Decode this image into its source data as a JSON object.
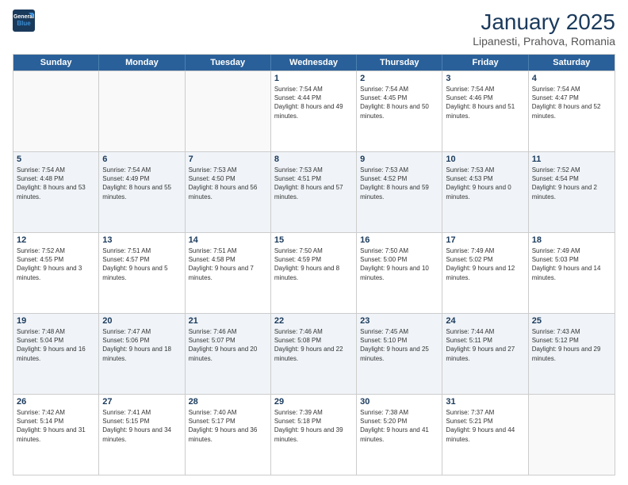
{
  "header": {
    "logo_line1": "General",
    "logo_line2": "Blue",
    "month": "January 2025",
    "location": "Lipanesti, Prahova, Romania"
  },
  "weekdays": [
    "Sunday",
    "Monday",
    "Tuesday",
    "Wednesday",
    "Thursday",
    "Friday",
    "Saturday"
  ],
  "rows": [
    [
      {
        "day": "",
        "sunrise": "",
        "sunset": "",
        "daylight": "",
        "empty": true
      },
      {
        "day": "",
        "sunrise": "",
        "sunset": "",
        "daylight": "",
        "empty": true
      },
      {
        "day": "",
        "sunrise": "",
        "sunset": "",
        "daylight": "",
        "empty": true
      },
      {
        "day": "1",
        "sunrise": "Sunrise: 7:54 AM",
        "sunset": "Sunset: 4:44 PM",
        "daylight": "Daylight: 8 hours and 49 minutes."
      },
      {
        "day": "2",
        "sunrise": "Sunrise: 7:54 AM",
        "sunset": "Sunset: 4:45 PM",
        "daylight": "Daylight: 8 hours and 50 minutes."
      },
      {
        "day": "3",
        "sunrise": "Sunrise: 7:54 AM",
        "sunset": "Sunset: 4:46 PM",
        "daylight": "Daylight: 8 hours and 51 minutes."
      },
      {
        "day": "4",
        "sunrise": "Sunrise: 7:54 AM",
        "sunset": "Sunset: 4:47 PM",
        "daylight": "Daylight: 8 hours and 52 minutes."
      }
    ],
    [
      {
        "day": "5",
        "sunrise": "Sunrise: 7:54 AM",
        "sunset": "Sunset: 4:48 PM",
        "daylight": "Daylight: 8 hours and 53 minutes."
      },
      {
        "day": "6",
        "sunrise": "Sunrise: 7:54 AM",
        "sunset": "Sunset: 4:49 PM",
        "daylight": "Daylight: 8 hours and 55 minutes."
      },
      {
        "day": "7",
        "sunrise": "Sunrise: 7:53 AM",
        "sunset": "Sunset: 4:50 PM",
        "daylight": "Daylight: 8 hours and 56 minutes."
      },
      {
        "day": "8",
        "sunrise": "Sunrise: 7:53 AM",
        "sunset": "Sunset: 4:51 PM",
        "daylight": "Daylight: 8 hours and 57 minutes."
      },
      {
        "day": "9",
        "sunrise": "Sunrise: 7:53 AM",
        "sunset": "Sunset: 4:52 PM",
        "daylight": "Daylight: 8 hours and 59 minutes."
      },
      {
        "day": "10",
        "sunrise": "Sunrise: 7:53 AM",
        "sunset": "Sunset: 4:53 PM",
        "daylight": "Daylight: 9 hours and 0 minutes."
      },
      {
        "day": "11",
        "sunrise": "Sunrise: 7:52 AM",
        "sunset": "Sunset: 4:54 PM",
        "daylight": "Daylight: 9 hours and 2 minutes."
      }
    ],
    [
      {
        "day": "12",
        "sunrise": "Sunrise: 7:52 AM",
        "sunset": "Sunset: 4:55 PM",
        "daylight": "Daylight: 9 hours and 3 minutes."
      },
      {
        "day": "13",
        "sunrise": "Sunrise: 7:51 AM",
        "sunset": "Sunset: 4:57 PM",
        "daylight": "Daylight: 9 hours and 5 minutes."
      },
      {
        "day": "14",
        "sunrise": "Sunrise: 7:51 AM",
        "sunset": "Sunset: 4:58 PM",
        "daylight": "Daylight: 9 hours and 7 minutes."
      },
      {
        "day": "15",
        "sunrise": "Sunrise: 7:50 AM",
        "sunset": "Sunset: 4:59 PM",
        "daylight": "Daylight: 9 hours and 8 minutes."
      },
      {
        "day": "16",
        "sunrise": "Sunrise: 7:50 AM",
        "sunset": "Sunset: 5:00 PM",
        "daylight": "Daylight: 9 hours and 10 minutes."
      },
      {
        "day": "17",
        "sunrise": "Sunrise: 7:49 AM",
        "sunset": "Sunset: 5:02 PM",
        "daylight": "Daylight: 9 hours and 12 minutes."
      },
      {
        "day": "18",
        "sunrise": "Sunrise: 7:49 AM",
        "sunset": "Sunset: 5:03 PM",
        "daylight": "Daylight: 9 hours and 14 minutes."
      }
    ],
    [
      {
        "day": "19",
        "sunrise": "Sunrise: 7:48 AM",
        "sunset": "Sunset: 5:04 PM",
        "daylight": "Daylight: 9 hours and 16 minutes."
      },
      {
        "day": "20",
        "sunrise": "Sunrise: 7:47 AM",
        "sunset": "Sunset: 5:06 PM",
        "daylight": "Daylight: 9 hours and 18 minutes."
      },
      {
        "day": "21",
        "sunrise": "Sunrise: 7:46 AM",
        "sunset": "Sunset: 5:07 PM",
        "daylight": "Daylight: 9 hours and 20 minutes."
      },
      {
        "day": "22",
        "sunrise": "Sunrise: 7:46 AM",
        "sunset": "Sunset: 5:08 PM",
        "daylight": "Daylight: 9 hours and 22 minutes."
      },
      {
        "day": "23",
        "sunrise": "Sunrise: 7:45 AM",
        "sunset": "Sunset: 5:10 PM",
        "daylight": "Daylight: 9 hours and 25 minutes."
      },
      {
        "day": "24",
        "sunrise": "Sunrise: 7:44 AM",
        "sunset": "Sunset: 5:11 PM",
        "daylight": "Daylight: 9 hours and 27 minutes."
      },
      {
        "day": "25",
        "sunrise": "Sunrise: 7:43 AM",
        "sunset": "Sunset: 5:12 PM",
        "daylight": "Daylight: 9 hours and 29 minutes."
      }
    ],
    [
      {
        "day": "26",
        "sunrise": "Sunrise: 7:42 AM",
        "sunset": "Sunset: 5:14 PM",
        "daylight": "Daylight: 9 hours and 31 minutes."
      },
      {
        "day": "27",
        "sunrise": "Sunrise: 7:41 AM",
        "sunset": "Sunset: 5:15 PM",
        "daylight": "Daylight: 9 hours and 34 minutes."
      },
      {
        "day": "28",
        "sunrise": "Sunrise: 7:40 AM",
        "sunset": "Sunset: 5:17 PM",
        "daylight": "Daylight: 9 hours and 36 minutes."
      },
      {
        "day": "29",
        "sunrise": "Sunrise: 7:39 AM",
        "sunset": "Sunset: 5:18 PM",
        "daylight": "Daylight: 9 hours and 39 minutes."
      },
      {
        "day": "30",
        "sunrise": "Sunrise: 7:38 AM",
        "sunset": "Sunset: 5:20 PM",
        "daylight": "Daylight: 9 hours and 41 minutes."
      },
      {
        "day": "31",
        "sunrise": "Sunrise: 7:37 AM",
        "sunset": "Sunset: 5:21 PM",
        "daylight": "Daylight: 9 hours and 44 minutes."
      },
      {
        "day": "",
        "sunrise": "",
        "sunset": "",
        "daylight": "",
        "empty": true
      }
    ]
  ]
}
